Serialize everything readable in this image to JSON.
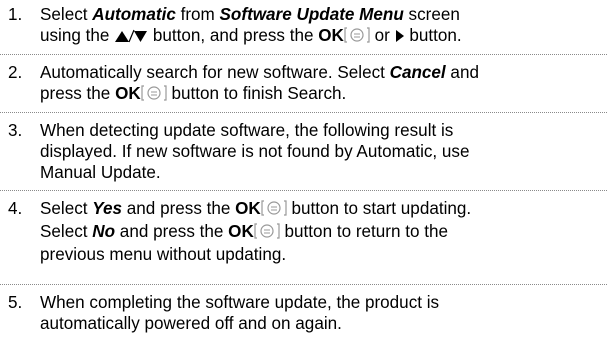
{
  "steps": [
    {
      "number": "1.",
      "line1": {
        "a": "Select ",
        "b": "Automatic",
        "c": " from ",
        "d": "Software Update Menu",
        "e": " screen"
      },
      "line2": {
        "a": "using the ",
        "b": " button, and press the ",
        "ok": "OK",
        "c": " or ",
        "d": " button."
      }
    },
    {
      "number": "2.",
      "line1": {
        "a": "Automatically search for new software. Select ",
        "b": "Cancel",
        "c": " and"
      },
      "line2": {
        "a": "press the ",
        "ok": "OK",
        "b": " button to finish Search."
      }
    },
    {
      "number": "3.",
      "line1": "When detecting update software, the following result is",
      "line2": "displayed. If new software is not found by Automatic, use",
      "line3": "Manual Update."
    },
    {
      "number": "4.",
      "line1": {
        "a": "Select ",
        "b": "Yes",
        "c": " and press the ",
        "ok": "OK",
        "d": " button to start updating."
      },
      "line2": {
        "a": "Select ",
        "b": "No",
        "c": " and press the ",
        "ok": "OK",
        "d": " button to return to the"
      },
      "line3": "previous menu without updating."
    },
    {
      "number": "5.",
      "line1": "When completing the software update, the product is",
      "line2": "automatically powered off and on again."
    }
  ],
  "icons": {
    "up_down": "up-down-arrow-icon",
    "ok_button": "ok-button-icon",
    "play_right": "right-arrow-icon"
  }
}
